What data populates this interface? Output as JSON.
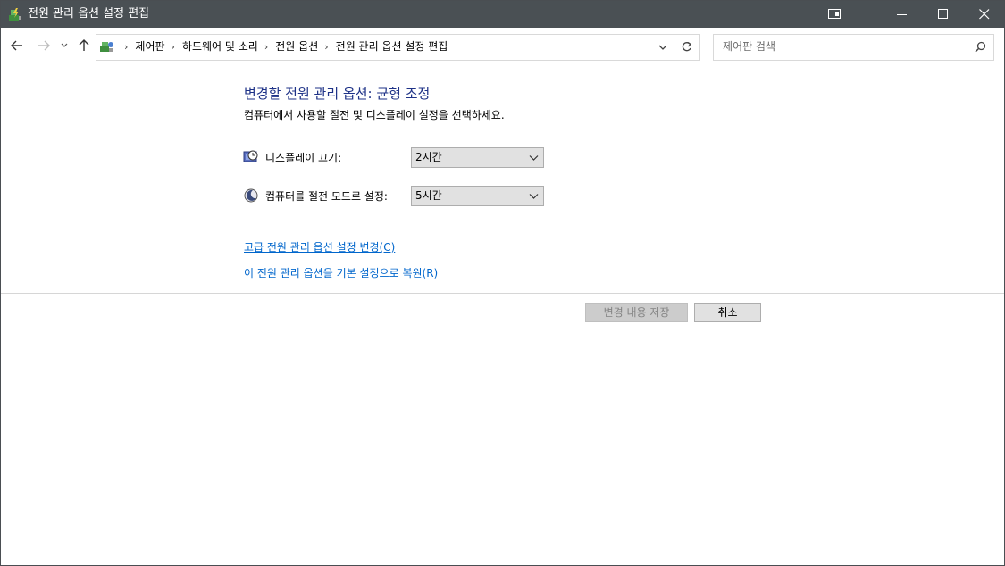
{
  "window": {
    "title": "전원 관리 옵션 설정 편집",
    "minimize_icon": "minimize-icon",
    "maximize_icon": "maximize-icon",
    "close_icon": "close-icon",
    "title_icon": "power-options-icon"
  },
  "nav": {
    "back_icon": "arrow-left-icon",
    "forward_icon": "arrow-right-icon",
    "recent_icon": "chevron-down-icon",
    "up_icon": "arrow-up-icon",
    "breadcrumbs": [
      "제어판",
      "하드웨어 및 소리",
      "전원 옵션",
      "전원 관리 옵션 설정 편집"
    ],
    "refresh_icon": "refresh-icon",
    "search_placeholder": "제어판 검색",
    "search_icon": "search-icon"
  },
  "content": {
    "heading": "변경할 전원 관리 옵션: 균형 조정",
    "subtitle": "컴퓨터에서 사용할 절전 및 디스플레이 설정을 선택하세요.",
    "settings": [
      {
        "label": "디스플레이 끄기:",
        "value": "2시간",
        "icon": "monitor-clock-icon"
      },
      {
        "label": "컴퓨터를 절전 모드로 설정:",
        "value": "5시간",
        "icon": "moon-sleep-icon"
      }
    ],
    "links": {
      "advanced": "고급 전원 관리 옵션 설정 변경(C)",
      "restore": "이 전원 관리 옵션을 기본 설정으로 복원(R)"
    }
  },
  "buttons": {
    "save": "변경 내용 저장",
    "cancel": "취소"
  },
  "colors": {
    "titlebar": "#4a5054",
    "heading": "#1e3287",
    "link": "#0066cc"
  }
}
